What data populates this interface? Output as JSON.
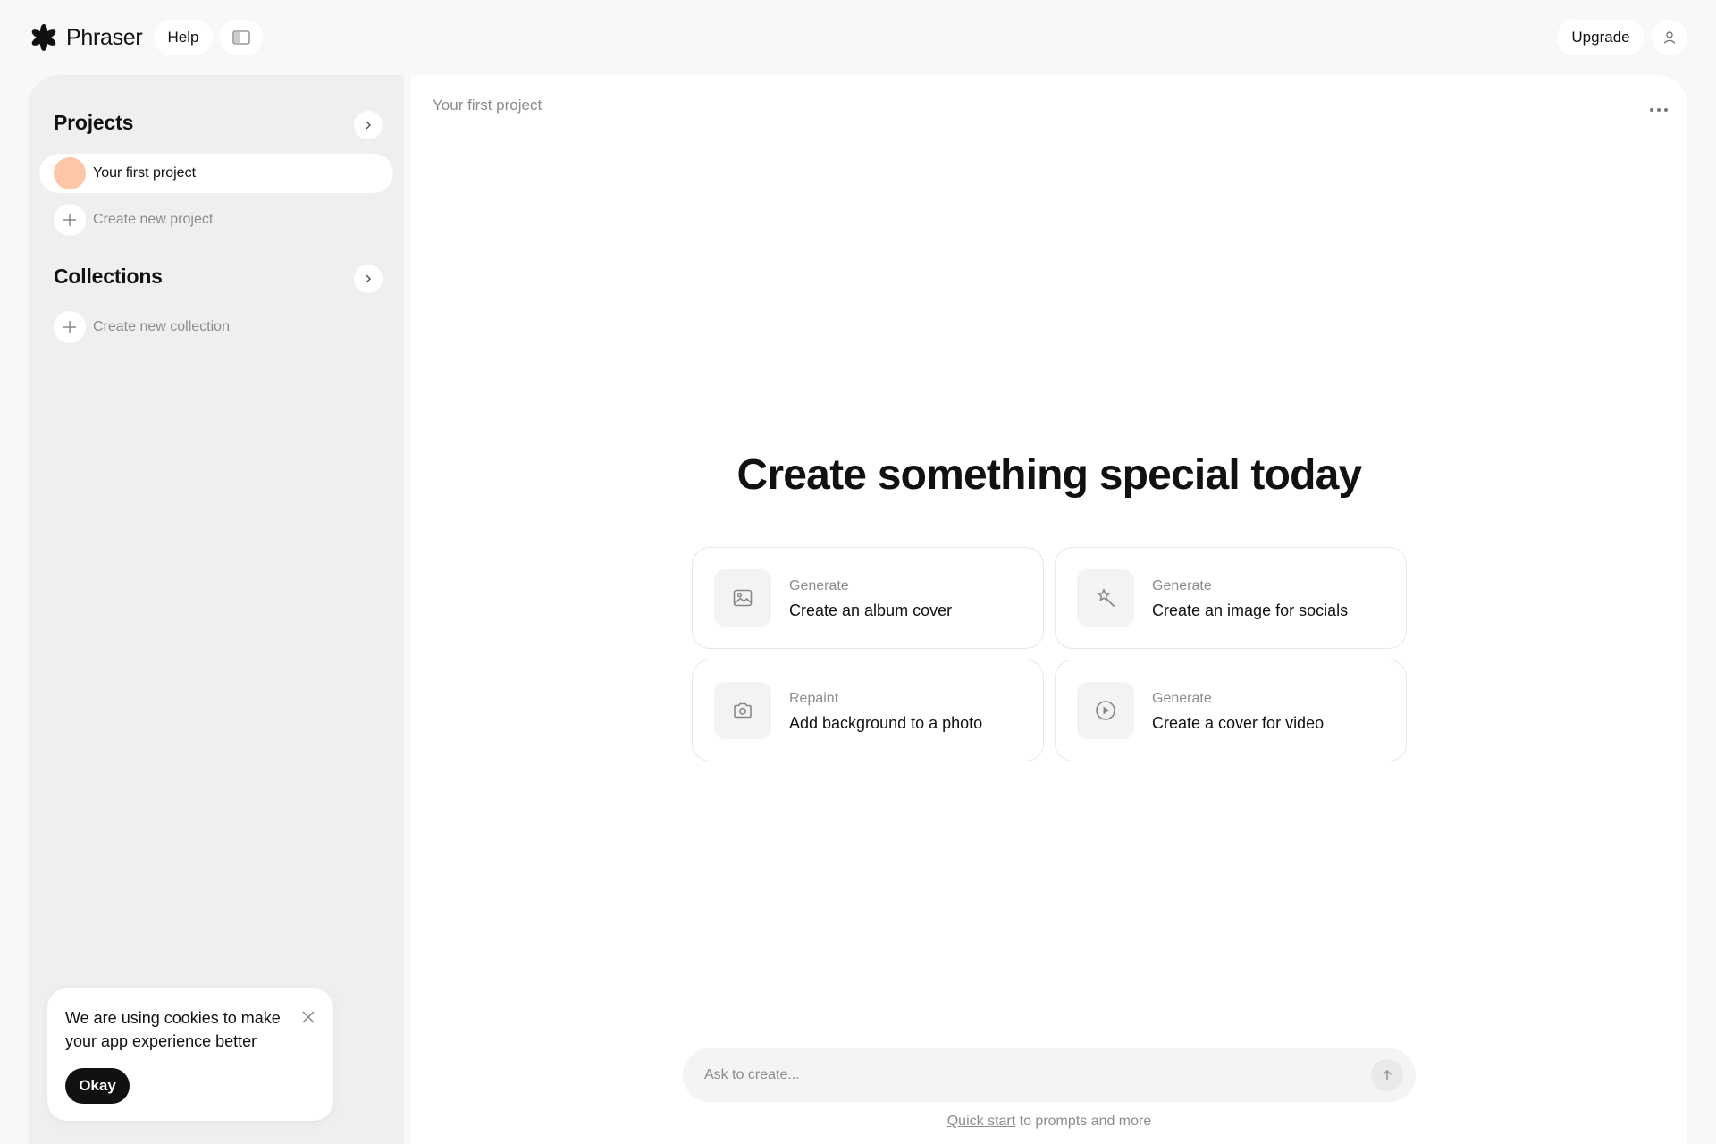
{
  "app": {
    "name": "Phraser"
  },
  "topbar": {
    "help_label": "Help",
    "upgrade_label": "Upgrade",
    "icons": {
      "logo": "asterisk-logo",
      "panel_toggle": "sidebar-toggle-icon",
      "profile": "user-icon"
    }
  },
  "sidebar": {
    "projects_title": "Projects",
    "projects": [
      {
        "label": "Your first project",
        "color": "#fdc6a6"
      }
    ],
    "create_project_label": "Create new project",
    "collections_title": "Collections",
    "create_collection_label": "Create new collection"
  },
  "cookie": {
    "message": "We are using cookies to make your app experience better",
    "ok_label": "Okay"
  },
  "main": {
    "project_title": "Your first project",
    "headline": "Create something special today",
    "cards": [
      {
        "kicker": "Generate",
        "title": "Create an album cover",
        "icon": "image-icon"
      },
      {
        "kicker": "Generate",
        "title": "Create an image for socials",
        "icon": "magic-wand-icon"
      },
      {
        "kicker": "Repaint",
        "title": "Add background to a photo",
        "icon": "camera-icon"
      },
      {
        "kicker": "Generate",
        "title": "Create a cover for video",
        "icon": "play-circle-icon"
      }
    ],
    "prompt": {
      "placeholder": "Ask to create...",
      "value": ""
    },
    "hint": {
      "link": "Quick start",
      "rest": " to prompts and more"
    }
  },
  "colors": {
    "accent_dark": "#111111",
    "muted_text": "#8c8c8c",
    "sidebar_bg": "#efefef",
    "project_dot": "#fdc6a6"
  }
}
